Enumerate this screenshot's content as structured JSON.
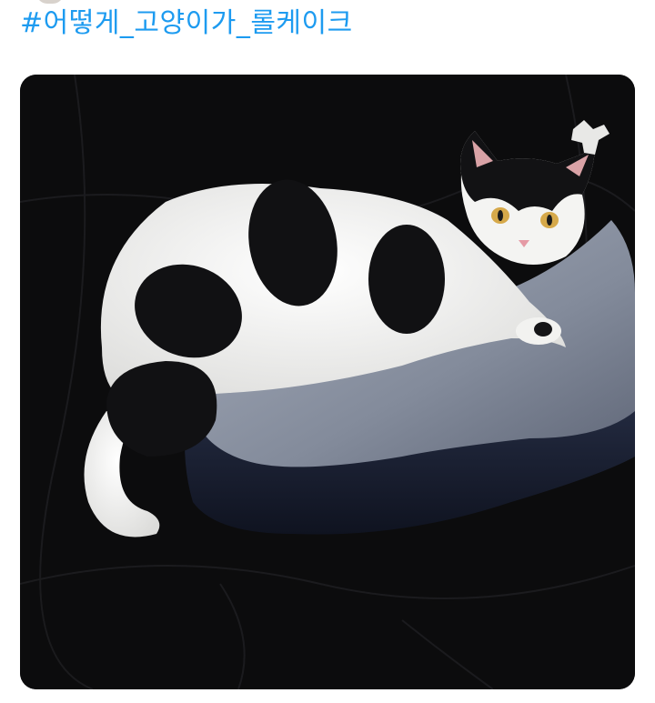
{
  "tweet": {
    "hashtag": "#어떻게_고양이가_롤케이크"
  },
  "media": {
    "icon": "photo-cat-on-pillow",
    "colors": {
      "background": "#0b0b0c",
      "pillow_top": "#8c95a6",
      "pillow_side": "#1c2233",
      "cat_white": "#f4f4f2",
      "cat_black": "#111113",
      "link": "#1d9bf0"
    }
  }
}
